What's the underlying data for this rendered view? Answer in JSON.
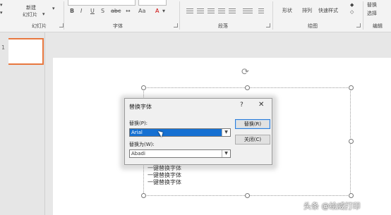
{
  "ribbon": {
    "new_slide_label": "新建",
    "new_slide_label2": "幻灯片",
    "group_slides": "幻灯片",
    "group_font": "字体",
    "group_paragraph": "段落",
    "group_drawing": "绘图",
    "group_editing": "编辑",
    "shape_label": "形状",
    "arrange_label": "排列",
    "quick_style_label": "快速样式",
    "replace_label": "替换",
    "select_label": "选择",
    "bold": "B",
    "italic": "I",
    "underline": "U",
    "strike": "S",
    "abc": "abc",
    "aa": "Aa",
    "font_color": "A"
  },
  "thumbnail": {
    "number": "1"
  },
  "slide": {
    "body_lines": [
      "一键替换字体",
      "一键替换字体",
      "一键替换字体"
    ]
  },
  "dialog": {
    "title": "替换字体",
    "help": "?",
    "close": "✕",
    "replace_label": "替换(P):",
    "replace_value": "Arial",
    "with_label": "替换为(W):",
    "with_value": "Abadi",
    "replace_button": "替换(R)",
    "close_button": "关闭(C)"
  },
  "watermark": "头条 @绘威打印"
}
